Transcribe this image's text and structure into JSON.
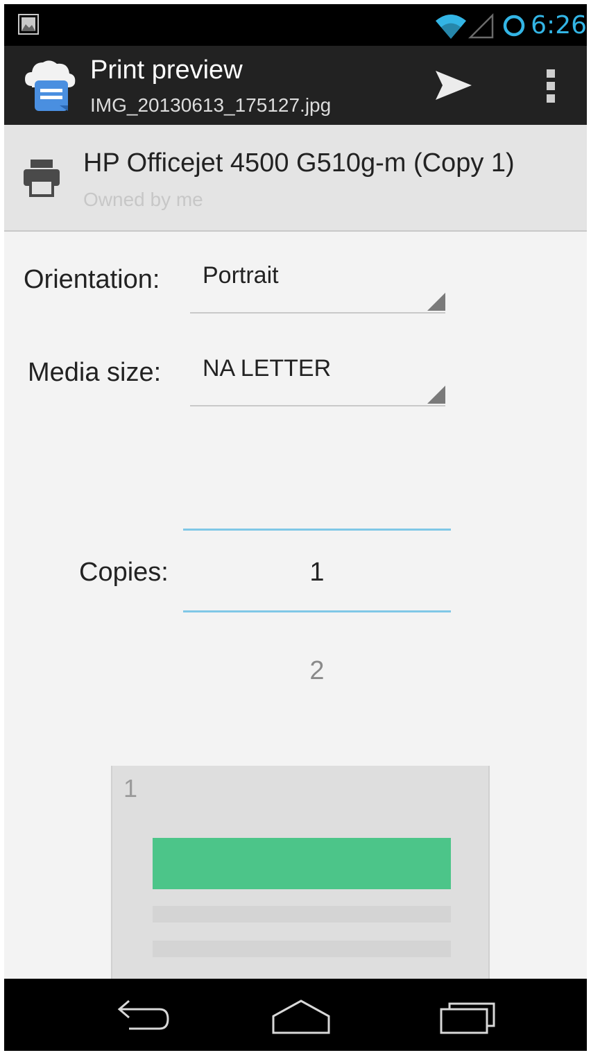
{
  "status_bar": {
    "time": "6:26",
    "accent_color": "#33b5e5"
  },
  "action_bar": {
    "title": "Print preview",
    "subtitle": "IMG_20130613_175127.jpg",
    "icons": [
      "cloud-print-icon",
      "send-icon",
      "overflow-menu-icon"
    ]
  },
  "printer": {
    "name": "HP Officejet 4500 G510g-m (Copy 1)",
    "owner": "Owned by me"
  },
  "form": {
    "orientation_label": "Orientation:",
    "orientation_value": "Portrait",
    "media_size_label": "Media size:",
    "media_size_value": "NA LETTER",
    "copies_label": "Copies:",
    "copies_value": "1",
    "copies_next": "2"
  },
  "preview": {
    "page_number": "1",
    "image_color": "#4cc589"
  },
  "nav_bar": {
    "icons": [
      "back-icon",
      "home-icon",
      "recents-icon"
    ]
  }
}
